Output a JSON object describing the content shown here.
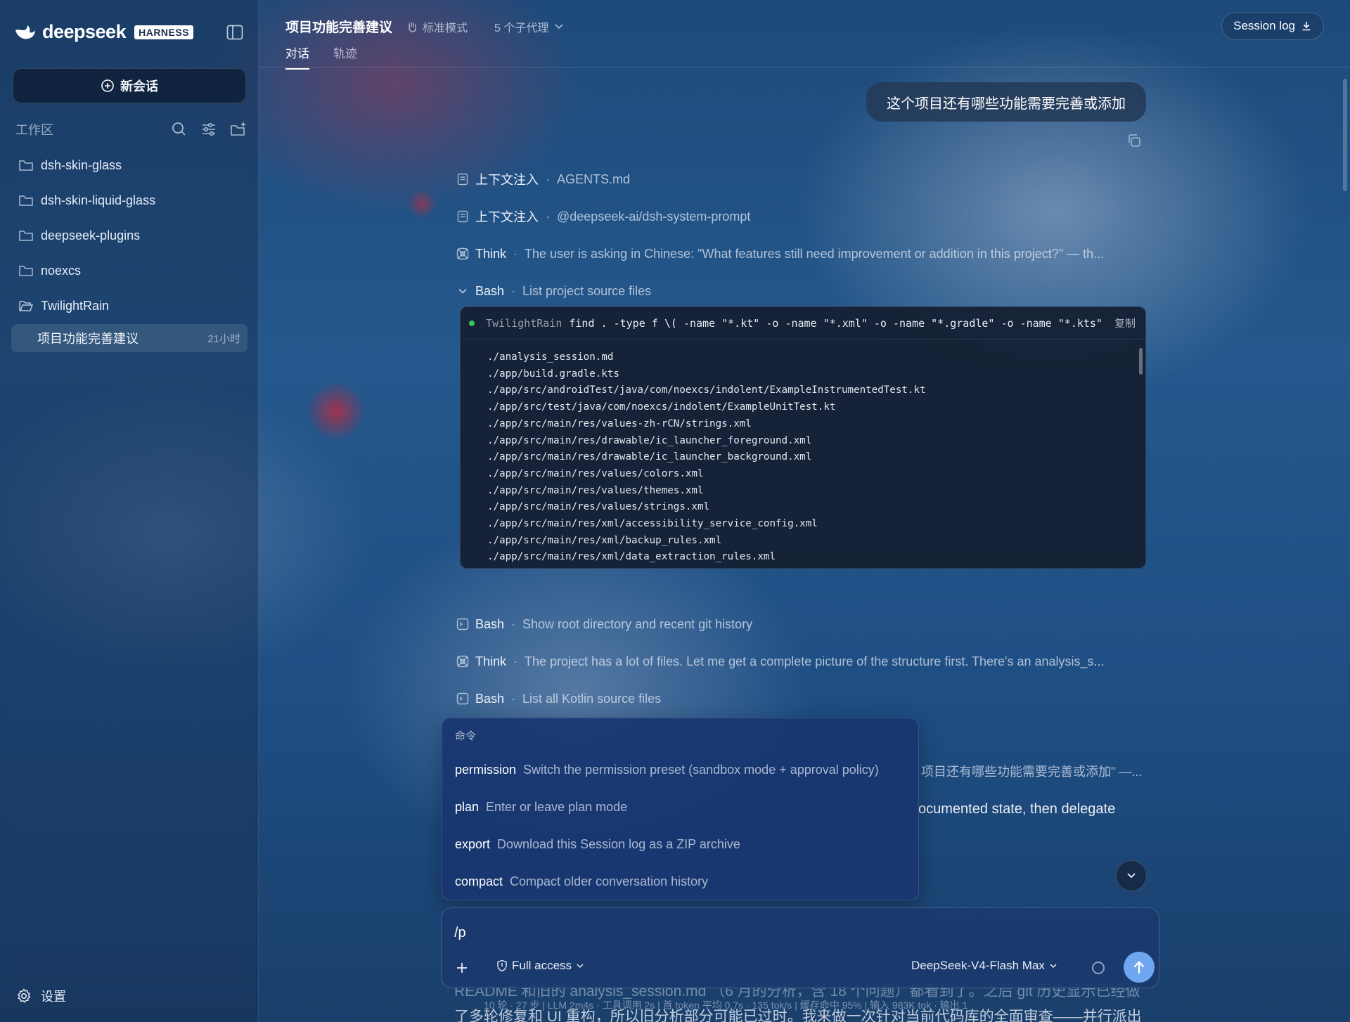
{
  "sidebar": {
    "brand": "deepseek",
    "badge": "HARNESS",
    "new_chat": "新会话",
    "workspace_title": "工作区",
    "workspaces": [
      {
        "name": "dsh-skin-glass"
      },
      {
        "name": "dsh-skin-liquid-glass"
      },
      {
        "name": "deepseek-plugins"
      },
      {
        "name": "noexcs"
      },
      {
        "name": "TwilightRain"
      }
    ],
    "active_session": {
      "title": "项目功能完善建议",
      "age": "21小时"
    },
    "settings": "设置"
  },
  "topbar": {
    "title": "项目功能完善建议",
    "mode": "标准模式",
    "agents": "5 个子代理",
    "tabs": [
      {
        "label": "对话"
      },
      {
        "label": "轨迹"
      }
    ],
    "session_log": "Session log"
  },
  "chat": {
    "user_message": "这个项目还有哪些功能需要完善或添加",
    "steps": [
      {
        "kind": "上下文注入",
        "detail": "AGENTS.md",
        "icon": "document-icon"
      },
      {
        "kind": "上下文注入",
        "detail": "@deepseek-ai/dsh-system-prompt",
        "icon": "document-icon"
      },
      {
        "kind": "Think",
        "detail": "The user is asking in Chinese: \"What features still need improvement or addition in this project?\" — th...",
        "icon": "brain-icon"
      },
      {
        "kind": "Bash",
        "detail": "List project source files",
        "icon": "chevron-down-icon"
      },
      {
        "kind": "Bash",
        "detail": "Show root directory and recent git history",
        "icon": "terminal-icon"
      },
      {
        "kind": "Think",
        "detail": "The project has a lot of files. Let me get a complete picture of the structure first. There's an analysis_s...",
        "icon": "brain-icon"
      },
      {
        "kind": "Bash",
        "detail": "List all Kotlin source files",
        "icon": "terminal-icon"
      }
    ],
    "terminal": {
      "cwd": "TwilightRain",
      "command": "find . -type f \\( -name \"*.kt\" -o -name \"*.xml\" -o -name \"*.gradle\" -o -name \"*.kts\" -...",
      "copy_label": "复制",
      "output": [
        "./analysis_session.md",
        "./app/build.gradle.kts",
        "./app/src/androidTest/java/com/noexcs/indolent/ExampleInstrumentedTest.kt",
        "./app/src/test/java/com/noexcs/indolent/ExampleUnitTest.kt",
        "./app/src/main/res/values-zh-rCN/strings.xml",
        "./app/src/main/res/drawable/ic_launcher_foreground.xml",
        "./app/src/main/res/drawable/ic_launcher_background.xml",
        "./app/src/main/res/values/colors.xml",
        "./app/src/main/res/values/themes.xml",
        "./app/src/main/res/values/strings.xml",
        "./app/src/main/res/xml/accessibility_service_config.xml",
        "./app/src/main/res/xml/backup_rules.xml",
        "./app/src/main/res/xml/data_extraction_rules.xml"
      ]
    },
    "partial_think": "项目还有哪些功能需要完善或添加\" —...",
    "partial_text": "ocumented state, then delegate",
    "peek_text": "README 和旧的 analysis_session.md （6 月的分析，含 18 个问题）都看到了。之后 git 历史显示已经做",
    "stats": "10 轮 · 27 步  |  LLM 2m4s · 工具调用 2s  |  首 token 平均 0.7s · 135 tok/s  |  缓存命中 95%  |  输入 983K tok · 输出 1",
    "peek_text2": "了多轮修复和 UI 重构，所以旧分析部分可能已过时。我来做一次针对当前代码库的全面审查——并行派出"
  },
  "palette": {
    "title": "命令",
    "commands": [
      {
        "name": "permission",
        "desc": "Switch the permission preset (sandbox mode + approval policy)"
      },
      {
        "name": "plan",
        "desc": "Enter or leave plan mode"
      },
      {
        "name": "export",
        "desc": "Download this Session log as a ZIP archive"
      },
      {
        "name": "compact",
        "desc": "Compact older conversation history"
      }
    ]
  },
  "composer": {
    "value": "/p",
    "permission": "Full access",
    "model": "DeepSeek-V4-Flash Max"
  },
  "colors": {
    "accent": "#6ea7ef",
    "status_green": "#34c759"
  }
}
